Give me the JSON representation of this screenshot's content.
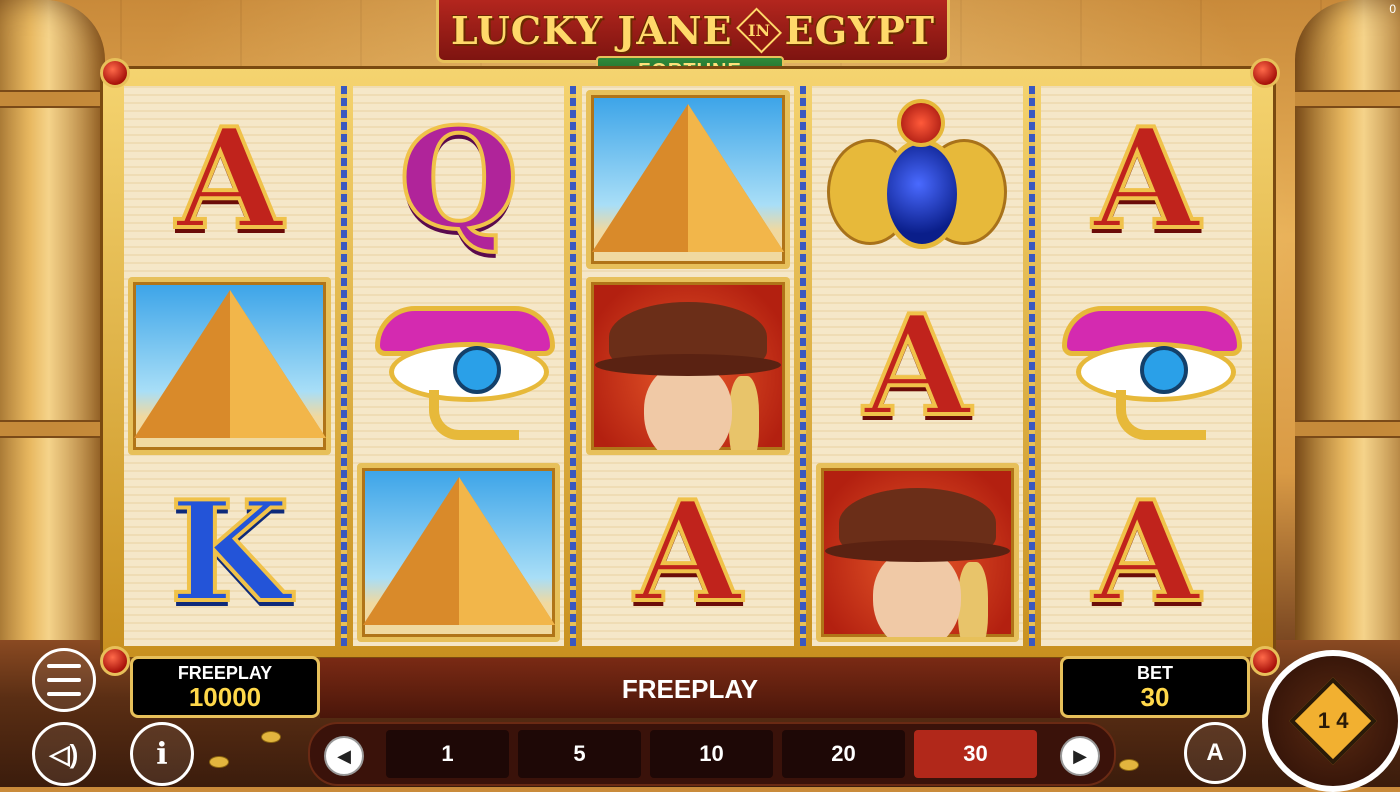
{
  "game": {
    "title_left": "LUCKY JANE",
    "title_in": "IN",
    "title_right": "EGYPT",
    "subtitle": "FORTUNE"
  },
  "reels": [
    [
      "A",
      "pyramid",
      "K"
    ],
    [
      "Q",
      "eye-of-horus",
      "pyramid"
    ],
    [
      "pyramid",
      "lucky-jane",
      "A"
    ],
    [
      "scarab",
      "A",
      "lucky-jane"
    ],
    [
      "A",
      "eye-of-horus",
      "A"
    ]
  ],
  "hud": {
    "balance_label": "FREEPLAY",
    "balance_value": "10000",
    "message": "FREEPLAY",
    "bet_label": "BET",
    "bet_value": "30",
    "corner_counter": "0"
  },
  "bet_options": [
    "1",
    "5",
    "10",
    "20",
    "30"
  ],
  "selected_bet": "30",
  "spin_icon_text": "1 4",
  "icons": {
    "menu": "hamburger-menu-icon",
    "sound": "speaker-icon",
    "info": "info-icon",
    "autoplay": "autoplay-a-icon",
    "prev": "chevron-left-icon",
    "next": "chevron-right-icon",
    "spin": "spin-arrows-icon"
  },
  "colors": {
    "gold": "#e7c05a",
    "selected_bet": "#b1281a",
    "value_yellow": "#ffd84a"
  }
}
